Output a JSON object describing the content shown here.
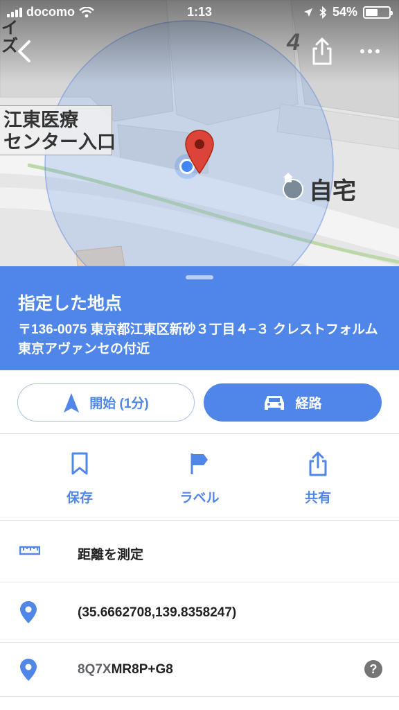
{
  "status_bar": {
    "carrier": "docomo",
    "time": "1:13",
    "battery_percent": "54%",
    "battery_level": 0.54
  },
  "map": {
    "label_box": "江東医療\nセンター入口",
    "corner_text": "イ\nズ",
    "block_number": "4",
    "home_label": "自宅",
    "icons": [
      "back-icon",
      "share-icon",
      "more-icon",
      "location-dot-icon",
      "red-pin-icon",
      "home-icon"
    ]
  },
  "place": {
    "title": "指定した地点",
    "address": "〒136-0075 東京都江東区新砂３丁目４−３ クレストフォルム東京アヴァンセの付近"
  },
  "actions": {
    "start_label": "開始 (1分)",
    "route_label": "経路"
  },
  "quick_actions": [
    {
      "label": "保存",
      "icon": "bookmark-icon"
    },
    {
      "label": "ラベル",
      "icon": "flag-icon"
    },
    {
      "label": "共有",
      "icon": "share-icon"
    }
  ],
  "rows": {
    "measure": "距離を測定",
    "coordinates": "(35.6662708,139.8358247)",
    "plus_code_prefix": "8Q7X",
    "plus_code_suffix": "MR8P+G8"
  },
  "colors": {
    "accent": "#4f86e8",
    "pin": "#db4437",
    "location_dot": "#4285f4"
  }
}
